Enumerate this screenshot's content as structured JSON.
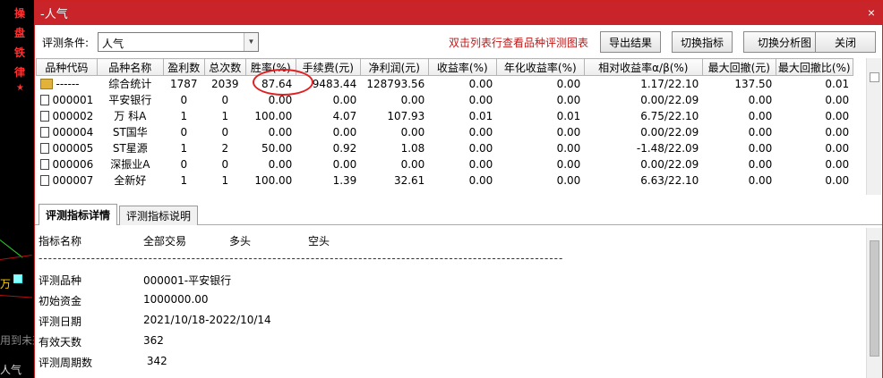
{
  "background_app": {
    "side_chars": [
      "操",
      "盘",
      "铁",
      "律"
    ],
    "side_label": "万",
    "bottom_text": "用到未来",
    "bottom_tab": "人气"
  },
  "window": {
    "title": "-人气",
    "close_glyph": "×"
  },
  "toolbar": {
    "condition_label": "评测条件:",
    "condition_value": "人气",
    "hint": "双击列表行查看品种评测图表",
    "buttons": [
      "导出结果",
      "切换指标",
      "切换分析图",
      "关闭"
    ]
  },
  "table": {
    "columns": [
      "品种代码",
      "品种名称",
      "盈利数",
      "总次数",
      "胜率(%)",
      "手续费(元)",
      "净利润(元)",
      "收益率(%)",
      "年化收益率(%)",
      "相对收益率α/β(%)",
      "最大回撤(元)",
      "最大回撤比(%)"
    ],
    "rows": [
      [
        "------",
        "综合统计",
        "1787",
        "2039",
        "87.64",
        "9483.44",
        "128793.56",
        "0.00",
        "0.00",
        "1.17/22.10",
        "137.50",
        "0.01"
      ],
      [
        "000001",
        "平安银行",
        "0",
        "0",
        "0.00",
        "0.00",
        "0.00",
        "0.00",
        "0.00",
        "0.00/22.09",
        "0.00",
        "0.00"
      ],
      [
        "000002",
        "万 科A",
        "1",
        "1",
        "100.00",
        "4.07",
        "107.93",
        "0.01",
        "0.01",
        "6.75/22.10",
        "0.00",
        "0.00"
      ],
      [
        "000004",
        "ST国华",
        "0",
        "0",
        "0.00",
        "0.00",
        "0.00",
        "0.00",
        "0.00",
        "0.00/22.09",
        "0.00",
        "0.00"
      ],
      [
        "000005",
        "ST星源",
        "1",
        "2",
        "50.00",
        "0.92",
        "1.08",
        "0.00",
        "0.00",
        "-1.48/22.09",
        "0.00",
        "0.00"
      ],
      [
        "000006",
        "深振业A",
        "0",
        "0",
        "0.00",
        "0.00",
        "0.00",
        "0.00",
        "0.00",
        "0.00/22.09",
        "0.00",
        "0.00"
      ],
      [
        "000007",
        "全新好",
        "1",
        "1",
        "100.00",
        "1.39",
        "32.61",
        "0.00",
        "0.00",
        "6.63/22.10",
        "0.00",
        "0.00"
      ]
    ]
  },
  "tabs": [
    "评测指标详情",
    "评测指标说明"
  ],
  "detail": {
    "header": [
      "指标名称",
      "全部交易",
      "多头",
      "空头"
    ],
    "dashes": "--------------------------------------------------------------------------------------------------------------",
    "items": [
      {
        "label": "评测品种",
        "value": "000001-平安银行"
      },
      {
        "label": "初始资金",
        "value": "1000000.00"
      },
      {
        "label": "评测日期",
        "value": "2021/10/18-2022/10/14"
      },
      {
        "label": "有效天数",
        "value": "362"
      },
      {
        "label": "评测周期数",
        "value": " 342"
      }
    ]
  }
}
